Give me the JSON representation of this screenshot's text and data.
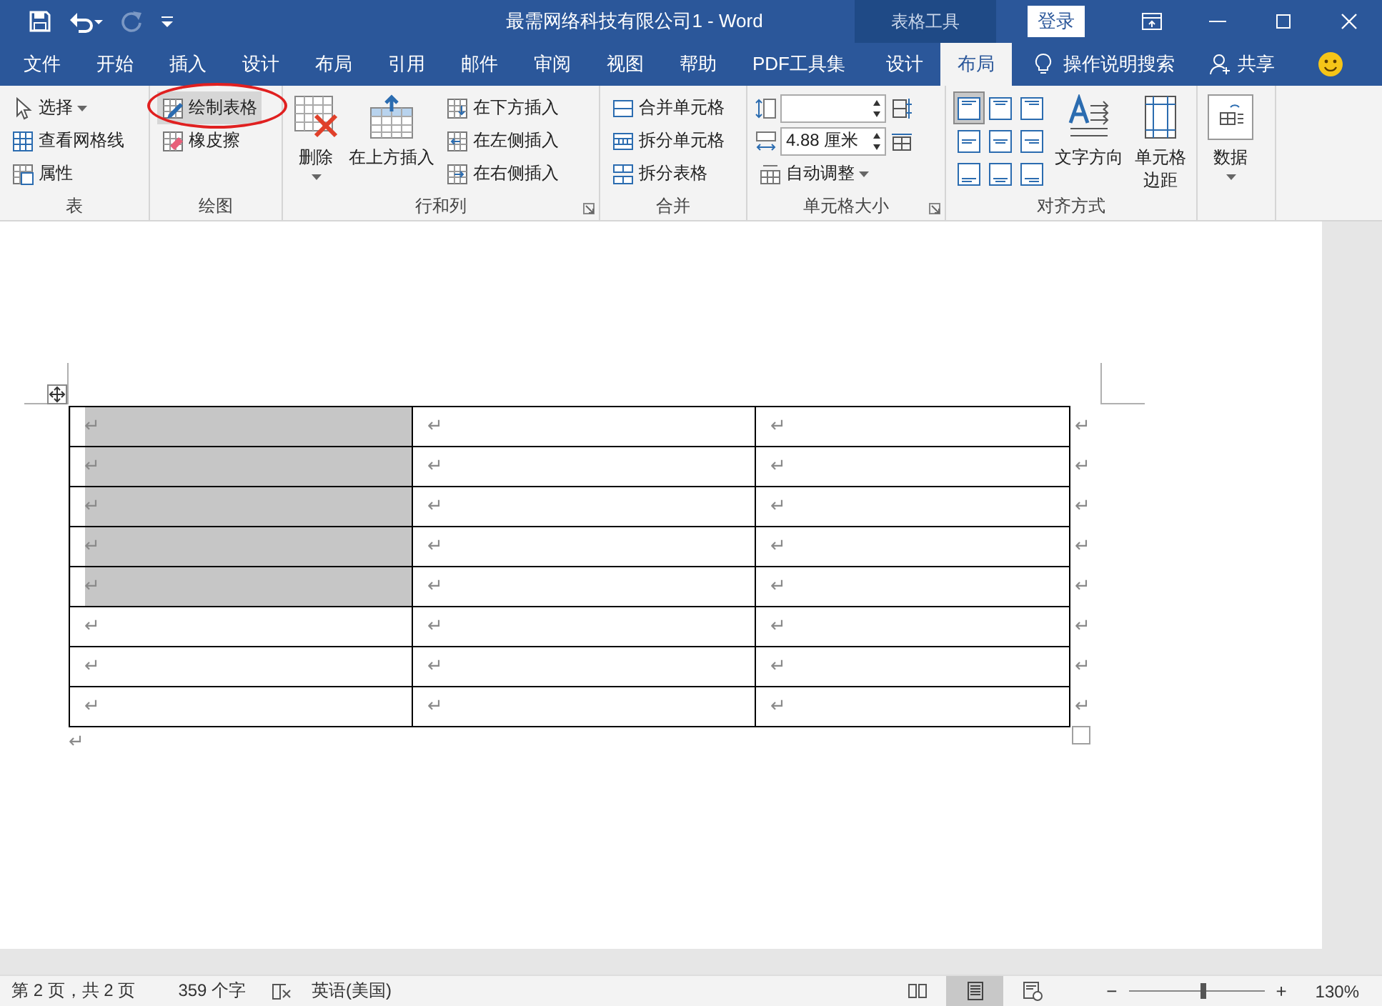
{
  "title_bar": {
    "title": "最需网络科技有限公司1  -  Word",
    "context_label": "表格工具",
    "login_button": "登录"
  },
  "menu_tabs": [
    {
      "label": "文件",
      "selected": false,
      "contextual": false
    },
    {
      "label": "开始",
      "selected": false,
      "contextual": false
    },
    {
      "label": "插入",
      "selected": false,
      "contextual": false
    },
    {
      "label": "设计",
      "selected": false,
      "contextual": false
    },
    {
      "label": "布局",
      "selected": false,
      "contextual": false
    },
    {
      "label": "引用",
      "selected": false,
      "contextual": false
    },
    {
      "label": "邮件",
      "selected": false,
      "contextual": false
    },
    {
      "label": "审阅",
      "selected": false,
      "contextual": false
    },
    {
      "label": "视图",
      "selected": false,
      "contextual": false
    },
    {
      "label": "帮助",
      "selected": false,
      "contextual": false
    },
    {
      "label": "PDF工具集",
      "selected": false,
      "contextual": false
    },
    {
      "label": "设计",
      "selected": false,
      "contextual": true
    },
    {
      "label": "布局",
      "selected": true,
      "contextual": true
    }
  ],
  "tell_me": "操作说明搜索",
  "share": "共享",
  "ribbon": {
    "groups": [
      {
        "label": "表",
        "columns": [
          [
            {
              "kind": "small",
              "label": "选择",
              "dropdown": true,
              "selected": false
            },
            {
              "kind": "small",
              "label": "查看网格线",
              "dropdown": false,
              "selected": false
            },
            {
              "kind": "small",
              "label": "属性",
              "dropdown": false,
              "selected": false
            }
          ]
        ]
      },
      {
        "label": "绘图",
        "columns": [
          [
            {
              "kind": "small",
              "label": "绘制表格",
              "dropdown": false,
              "selected": true,
              "annotated": true
            },
            {
              "kind": "small",
              "label": "橡皮擦",
              "dropdown": false,
              "selected": false
            }
          ]
        ]
      },
      {
        "label": "行和列",
        "launcher": true,
        "columns": [
          [
            {
              "kind": "large",
              "label": "删除",
              "dropdown": true,
              "selected": false
            }
          ],
          [
            {
              "kind": "large",
              "label": "在上方插入",
              "dropdown": false,
              "selected": false
            }
          ],
          [
            {
              "kind": "small",
              "label": "在下方插入",
              "dropdown": false,
              "selected": false
            },
            {
              "kind": "small",
              "label": "在左侧插入",
              "dropdown": false,
              "selected": false
            },
            {
              "kind": "small",
              "label": "在右侧插入",
              "dropdown": false,
              "selected": false
            }
          ]
        ]
      },
      {
        "label": "合并",
        "columns": [
          [
            {
              "kind": "small",
              "label": "合并单元格",
              "dropdown": false,
              "selected": false
            },
            {
              "kind": "small",
              "label": "拆分单元格",
              "dropdown": false,
              "selected": false
            },
            {
              "kind": "small",
              "label": "拆分表格",
              "dropdown": false,
              "selected": false
            }
          ]
        ]
      },
      {
        "label": "单元格大小",
        "launcher": true,
        "columns": [
          [
            {
              "kind": "field"
            },
            {
              "kind": "field",
              "value": "4.88 厘米"
            },
            {
              "kind": "small",
              "label": "自动调整",
              "dropdown": true,
              "selected": false
            }
          ],
          [
            {
              "kind": "icon"
            },
            {
              "kind": "icon"
            }
          ]
        ]
      },
      {
        "label": "对齐方式",
        "columns": [
          [
            {
              "kind": "align-grid",
              "cells": [
                {
                  "selected": true
                },
                {
                  "selected": false
                },
                {
                  "selected": false
                },
                {
                  "selected": false
                },
                {
                  "selected": false
                },
                {
                  "selected": false
                },
                {
                  "selected": false
                },
                {
                  "selected": false
                },
                {
                  "selected": false
                }
              ]
            }
          ],
          [
            {
              "kind": "large",
              "label": "文字方向",
              "dropdown": false,
              "selected": false
            }
          ],
          [
            {
              "kind": "large",
              "label": "单元格边距",
              "dropdown": false,
              "selected": false
            }
          ]
        ]
      },
      {
        "columns": [
          [
            {
              "kind": "large",
              "label": "数据",
              "dropdown": true,
              "selected": false
            }
          ]
        ]
      }
    ]
  },
  "document": {
    "table": {
      "rows": [
        {
          "cells": [
            {
              "mark": "↵",
              "selected": true
            },
            {
              "mark": "↵",
              "selected": false
            },
            {
              "mark": "↵",
              "selected": false
            }
          ],
          "end_mark": "↵"
        },
        {
          "cells": [
            {
              "mark": "↵",
              "selected": true
            },
            {
              "mark": "↵",
              "selected": false
            },
            {
              "mark": "↵",
              "selected": false
            }
          ],
          "end_mark": "↵"
        },
        {
          "cells": [
            {
              "mark": "↵",
              "selected": true
            },
            {
              "mark": "↵",
              "selected": false
            },
            {
              "mark": "↵",
              "selected": false
            }
          ],
          "end_mark": "↵"
        },
        {
          "cells": [
            {
              "mark": "↵",
              "selected": true
            },
            {
              "mark": "↵",
              "selected": false
            },
            {
              "mark": "↵",
              "selected": false
            }
          ],
          "end_mark": "↵"
        },
        {
          "cells": [
            {
              "mark": "↵",
              "selected": true
            },
            {
              "mark": "↵",
              "selected": false
            },
            {
              "mark": "↵",
              "selected": false
            }
          ],
          "end_mark": "↵"
        },
        {
          "cells": [
            {
              "mark": "↵",
              "selected": false
            },
            {
              "mark": "↵",
              "selected": false
            },
            {
              "mark": "↵",
              "selected": false
            }
          ],
          "end_mark": "↵"
        },
        {
          "cells": [
            {
              "mark": "↵",
              "selected": false
            },
            {
              "mark": "↵",
              "selected": false
            },
            {
              "mark": "↵",
              "selected": false
            }
          ],
          "end_mark": "↵"
        },
        {
          "cells": [
            {
              "mark": "↵",
              "selected": false
            },
            {
              "mark": "↵",
              "selected": false
            },
            {
              "mark": "↵",
              "selected": false
            }
          ],
          "end_mark": "↵"
        }
      ]
    },
    "after_mark": "↵"
  },
  "status_bar": {
    "page": "第 2 页，共 2 页",
    "words": "359 个字",
    "language": "英语(美国)",
    "views": [
      {
        "selected": false
      },
      {
        "selected": true
      },
      {
        "selected": false
      }
    ],
    "zoom_out": "−",
    "zoom_in": "+",
    "zoom": {
      "level": 0.55
    },
    "zoom_percent": "130%"
  }
}
